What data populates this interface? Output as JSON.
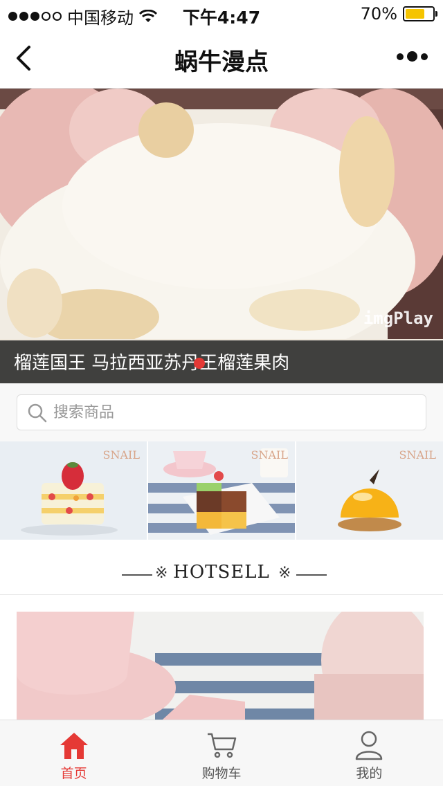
{
  "status_bar": {
    "carrier": "中国移动",
    "time": "下午4:47",
    "battery_text": "70%",
    "battery_level": 0.7
  },
  "nav": {
    "title": "蜗牛漫点"
  },
  "banner": {
    "caption": "榴莲国王 马拉西亚苏丹王榴莲果肉",
    "watermark": "imgPlay"
  },
  "search": {
    "placeholder": "搜索商品"
  },
  "tiles": [
    {
      "logo": "SNAIL"
    },
    {
      "logo": "SNAIL"
    },
    {
      "logo": "SNAIL"
    }
  ],
  "hotsell": {
    "title": "HOTSELL",
    "mark": "※"
  },
  "tabs": [
    {
      "label": "首页",
      "icon": "home-icon",
      "active": true
    },
    {
      "label": "购物车",
      "icon": "cart-icon",
      "active": false
    },
    {
      "label": "我的",
      "icon": "user-icon",
      "active": false
    }
  ],
  "colors": {
    "accent": "#e53935",
    "battery": "#f5c400"
  }
}
